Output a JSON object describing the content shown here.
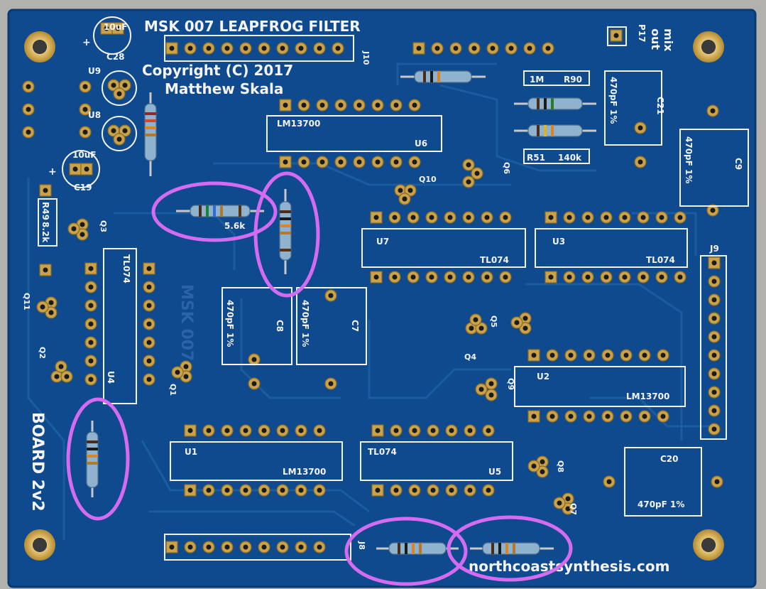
{
  "board": {
    "title": "MSK 007 LEAPFROG FILTER",
    "copyright": "Copyright (C) 2017",
    "author": "Matthew Skala",
    "revision": "BOARD 2v2",
    "website": "northcoastsynthesis.com",
    "faint_label": "MSK 007",
    "colors": {
      "pcb": "#0f4a8f",
      "silkscreen": "#f4f4f4",
      "pads": "#c9a24a",
      "highlight": "#d56bf0"
    }
  },
  "labels": {
    "j10": "J10",
    "j9": "J9",
    "j8": "J8",
    "p17": "P17",
    "mix": "mix",
    "out": "out",
    "c28": "C28",
    "c28_val": "10uF",
    "c19": "C19",
    "c19_val": "10uF",
    "plus": "+",
    "u9": "U9",
    "u8": "U8",
    "u6": "U6",
    "u6_part": "LM13700",
    "u7": "U7",
    "u7_part": "TL074",
    "u3": "U3",
    "u3_part": "TL074",
    "u2": "U2",
    "u2_part": "LM13700",
    "u1": "U1",
    "u1_part": "LM13700",
    "u5": "U5",
    "u5_part": "TL074",
    "u4": "U4",
    "u4_part": "TL074",
    "q1": "Q1",
    "q2": "Q2",
    "q3": "Q3",
    "q4": "Q4",
    "q5": "Q5",
    "q6": "Q6",
    "q7": "Q7",
    "q8": "Q8",
    "q9": "Q9",
    "q10": "Q10",
    "q11": "Q11",
    "r90": "R90",
    "r90_val": "1M",
    "r51": "R51",
    "r51_val": "140k",
    "r49": "R49",
    "r49_val": "8.2k",
    "r5_val": "5.6k",
    "c21": "C21",
    "c21_val": "470pF 1%",
    "c9": "C9",
    "c9_val": "470pF 1%",
    "c8": "C8",
    "c8_val": "470pF 1%",
    "c7": "C7",
    "c7_val": "470pF 1%",
    "c20": "C20",
    "c20_val": "470pF 1%"
  }
}
